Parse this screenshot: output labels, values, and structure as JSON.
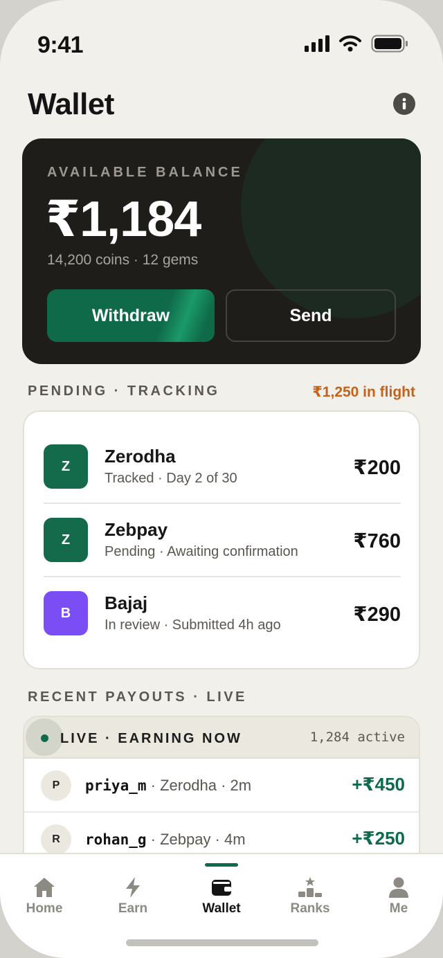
{
  "status_bar": {
    "time": "9:41"
  },
  "header": {
    "title": "Wallet"
  },
  "balance": {
    "label": "AVAILABLE BALANCE",
    "amount": "₹1,184",
    "subtitle": "14,200 coins · 12 gems",
    "withdraw_label": "Withdraw",
    "send_label": "Send"
  },
  "pending": {
    "title": "PENDING · TRACKING",
    "in_flight": "₹1,250 in flight",
    "items": [
      {
        "initial": "Z",
        "name": "Zerodha",
        "status": "Tracked · Day 2 of 30",
        "amount": "₹200",
        "color": "#136b4b"
      },
      {
        "initial": "Z",
        "name": "Zebpay",
        "status": "Pending · Awaiting confirmation",
        "amount": "₹760",
        "color": "#136b4b"
      },
      {
        "initial": "B",
        "name": "Bajaj",
        "status": "In review · Submitted 4h ago",
        "amount": "₹290",
        "color": "#7a4df5"
      }
    ]
  },
  "recent": {
    "title": "RECENT PAYOUTS · LIVE",
    "live_label": "LIVE · EARNING NOW",
    "active_count": "1,284 active",
    "items": [
      {
        "initial": "P",
        "user": "priya_m",
        "detail": " · Zerodha · 2m",
        "amount": "+₹450"
      },
      {
        "initial": "R",
        "user": "rohan_g",
        "detail": " · Zebpay · 4m",
        "amount": "+₹250"
      }
    ]
  },
  "tabs": [
    {
      "label": "Home",
      "icon": "home-icon",
      "active": false
    },
    {
      "label": "Earn",
      "icon": "bolt-icon",
      "active": false
    },
    {
      "label": "Wallet",
      "icon": "wallet-icon",
      "active": true
    },
    {
      "label": "Ranks",
      "icon": "podium-icon",
      "active": false
    },
    {
      "label": "Me",
      "icon": "person-icon",
      "active": false
    }
  ],
  "colors": {
    "accent": "#0f6a4a",
    "warning": "#c4621a",
    "card_dark": "#1f1d1a",
    "background": "#f2f0eb"
  }
}
